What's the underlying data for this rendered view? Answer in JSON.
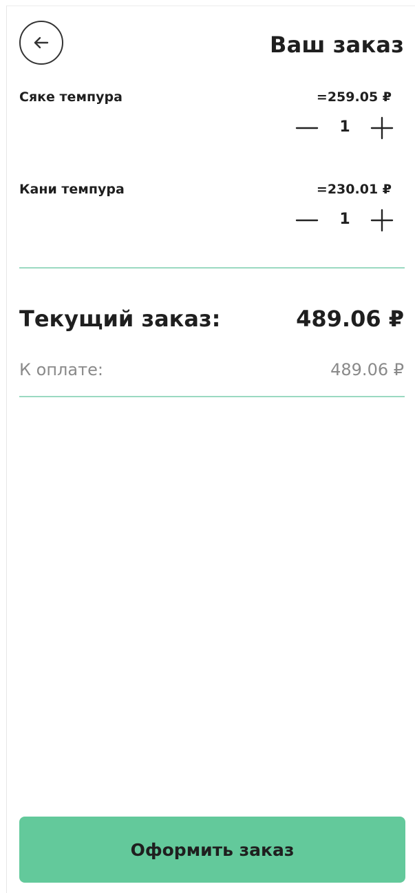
{
  "header": {
    "back_icon": "arrow-left-icon",
    "title": "Ваш заказ"
  },
  "items": [
    {
      "name": "Сяке темпура",
      "price": "=259.05 ₽",
      "quantity": "1"
    },
    {
      "name": "Кани темпура",
      "price": "=230.01 ₽",
      "quantity": "1"
    }
  ],
  "summary": {
    "total_label": "Текущий заказ:",
    "total_value": "489.06 ₽",
    "pay_label": "К оплате:",
    "pay_value": "489.06 ₽"
  },
  "actions": {
    "submit_label": "Оформить заказ"
  },
  "colors": {
    "accent": "#63c99b",
    "divider": "#9ad9c1",
    "text": "#1f1f1f",
    "muted": "#8a8a8a"
  }
}
